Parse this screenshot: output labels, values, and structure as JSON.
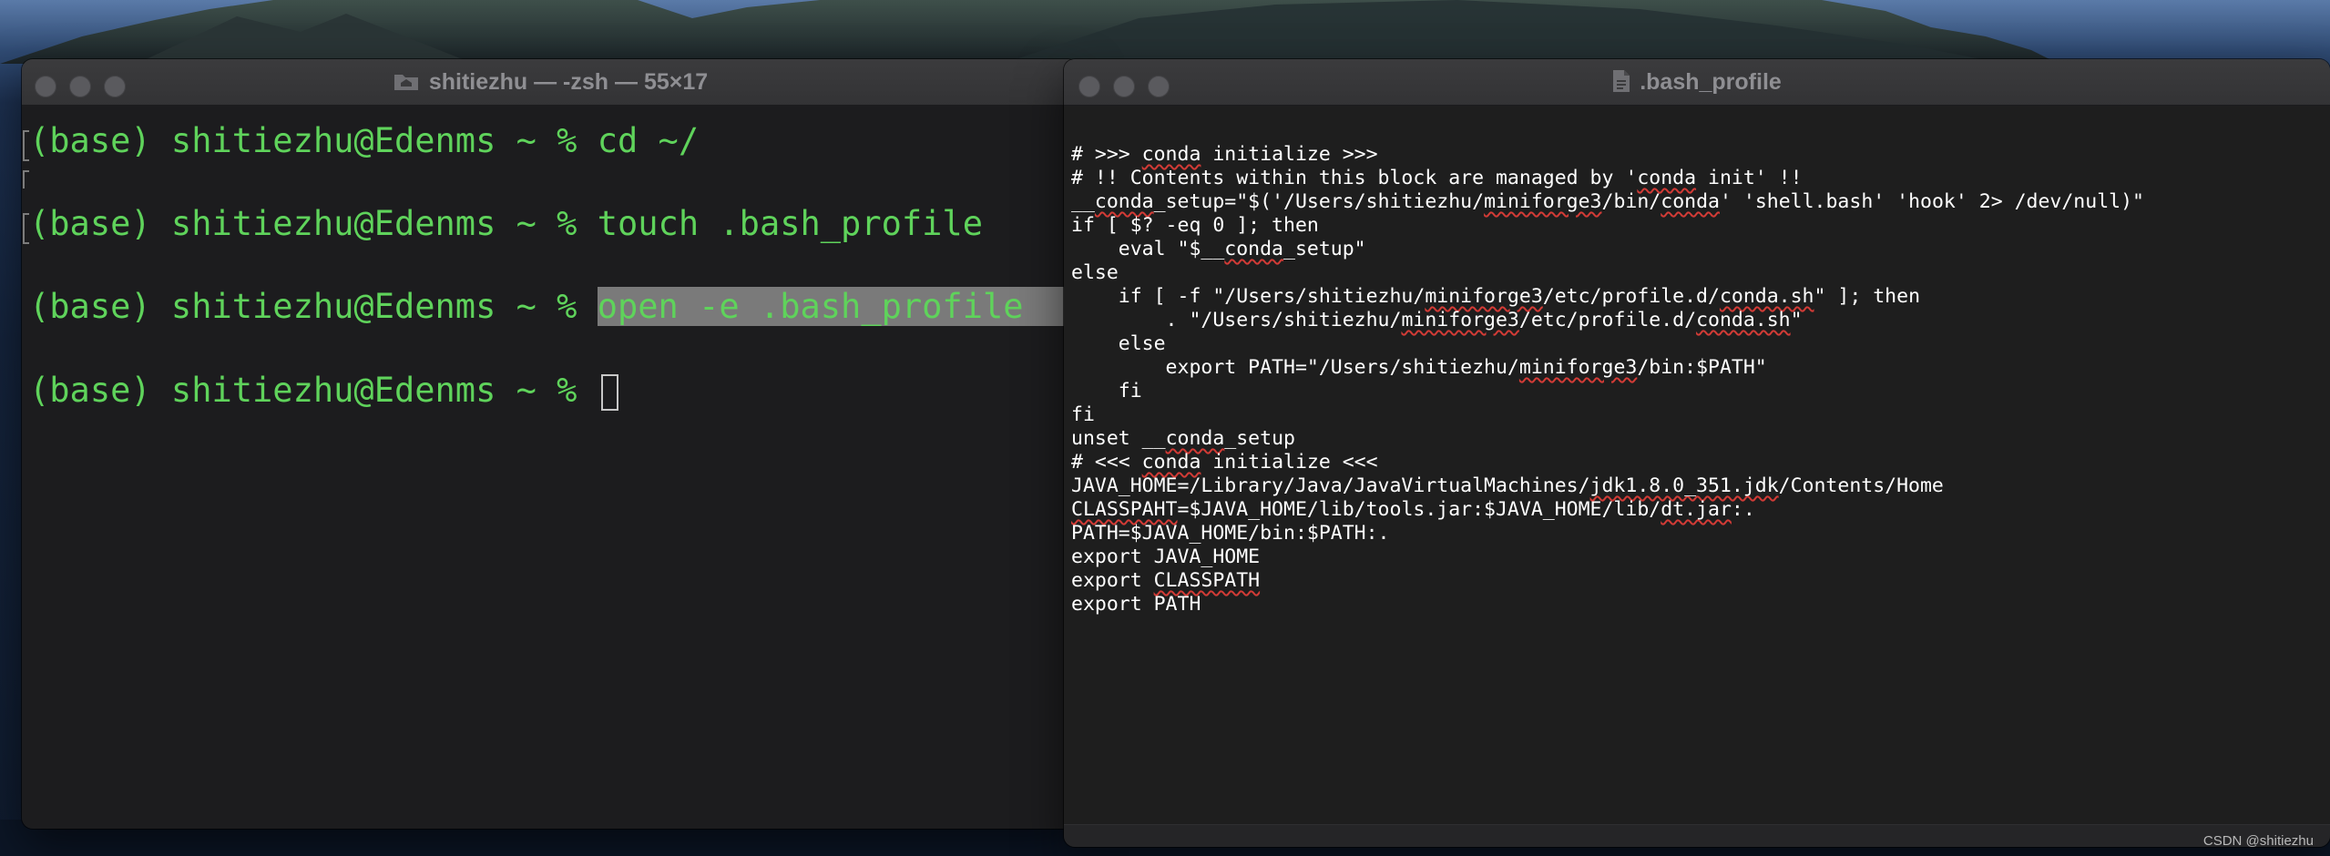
{
  "terminal": {
    "title": "shitiezhu — -zsh — 55×17",
    "lines": [
      {
        "prompt": "(base) shitiezhu@Edenms ~ % ",
        "command": "cd ~/"
      },
      {
        "prompt": "(base) shitiezhu@Edenms ~ % ",
        "command": "touch .bash_profile"
      },
      {
        "prompt": "(base) shitiezhu@Edenms ~ % ",
        "command": "open -e .bash_profile"
      },
      {
        "prompt": "(base) shitiezhu@Edenms ~ % ",
        "command": ""
      }
    ],
    "colors": {
      "text": "#5fd35b",
      "background": "#1c1c1e",
      "selection": "#7a7a7a"
    }
  },
  "editor": {
    "title": ".bash_profile",
    "file_icon": "document-icon",
    "lines": [
      "# >>> conda initialize >>>",
      "# !! Contents within this block are managed by 'conda init' !!",
      "__conda_setup=\"$('/Users/shitiezhu/miniforge3/bin/conda' 'shell.bash' 'hook' 2> /dev/null)\"",
      "if [ $? -eq 0 ]; then",
      "    eval \"$__conda_setup\"",
      "else",
      "    if [ -f \"/Users/shitiezhu/miniforge3/etc/profile.d/conda.sh\" ]; then",
      "        . \"/Users/shitiezhu/miniforge3/etc/profile.d/conda.sh\"",
      "    else",
      "        export PATH=\"/Users/shitiezhu/miniforge3/bin:$PATH\"",
      "    fi",
      "fi",
      "unset __conda_setup",
      "# <<< conda initialize <<<",
      "JAVA_HOME=/Library/Java/JavaVirtualMachines/jdk1.8.0_351.jdk/Contents/Home",
      "CLASSPAHT=$JAVA_HOME/lib/tools.jar:$JAVA_HOME/lib/dt.jar:.",
      "PATH=$JAVA_HOME/bin:$PATH:.",
      "export JAVA_HOME",
      "export CLASSPATH",
      "export PATH"
    ],
    "spellcheck_words": [
      "conda",
      "miniforge3",
      "jdk1.8.0_351.jdk",
      "CLASSPAHT",
      "dt.jar",
      "CLASSPATH",
      "conda.sh"
    ]
  },
  "watermark": "CSDN @shitiezhu"
}
